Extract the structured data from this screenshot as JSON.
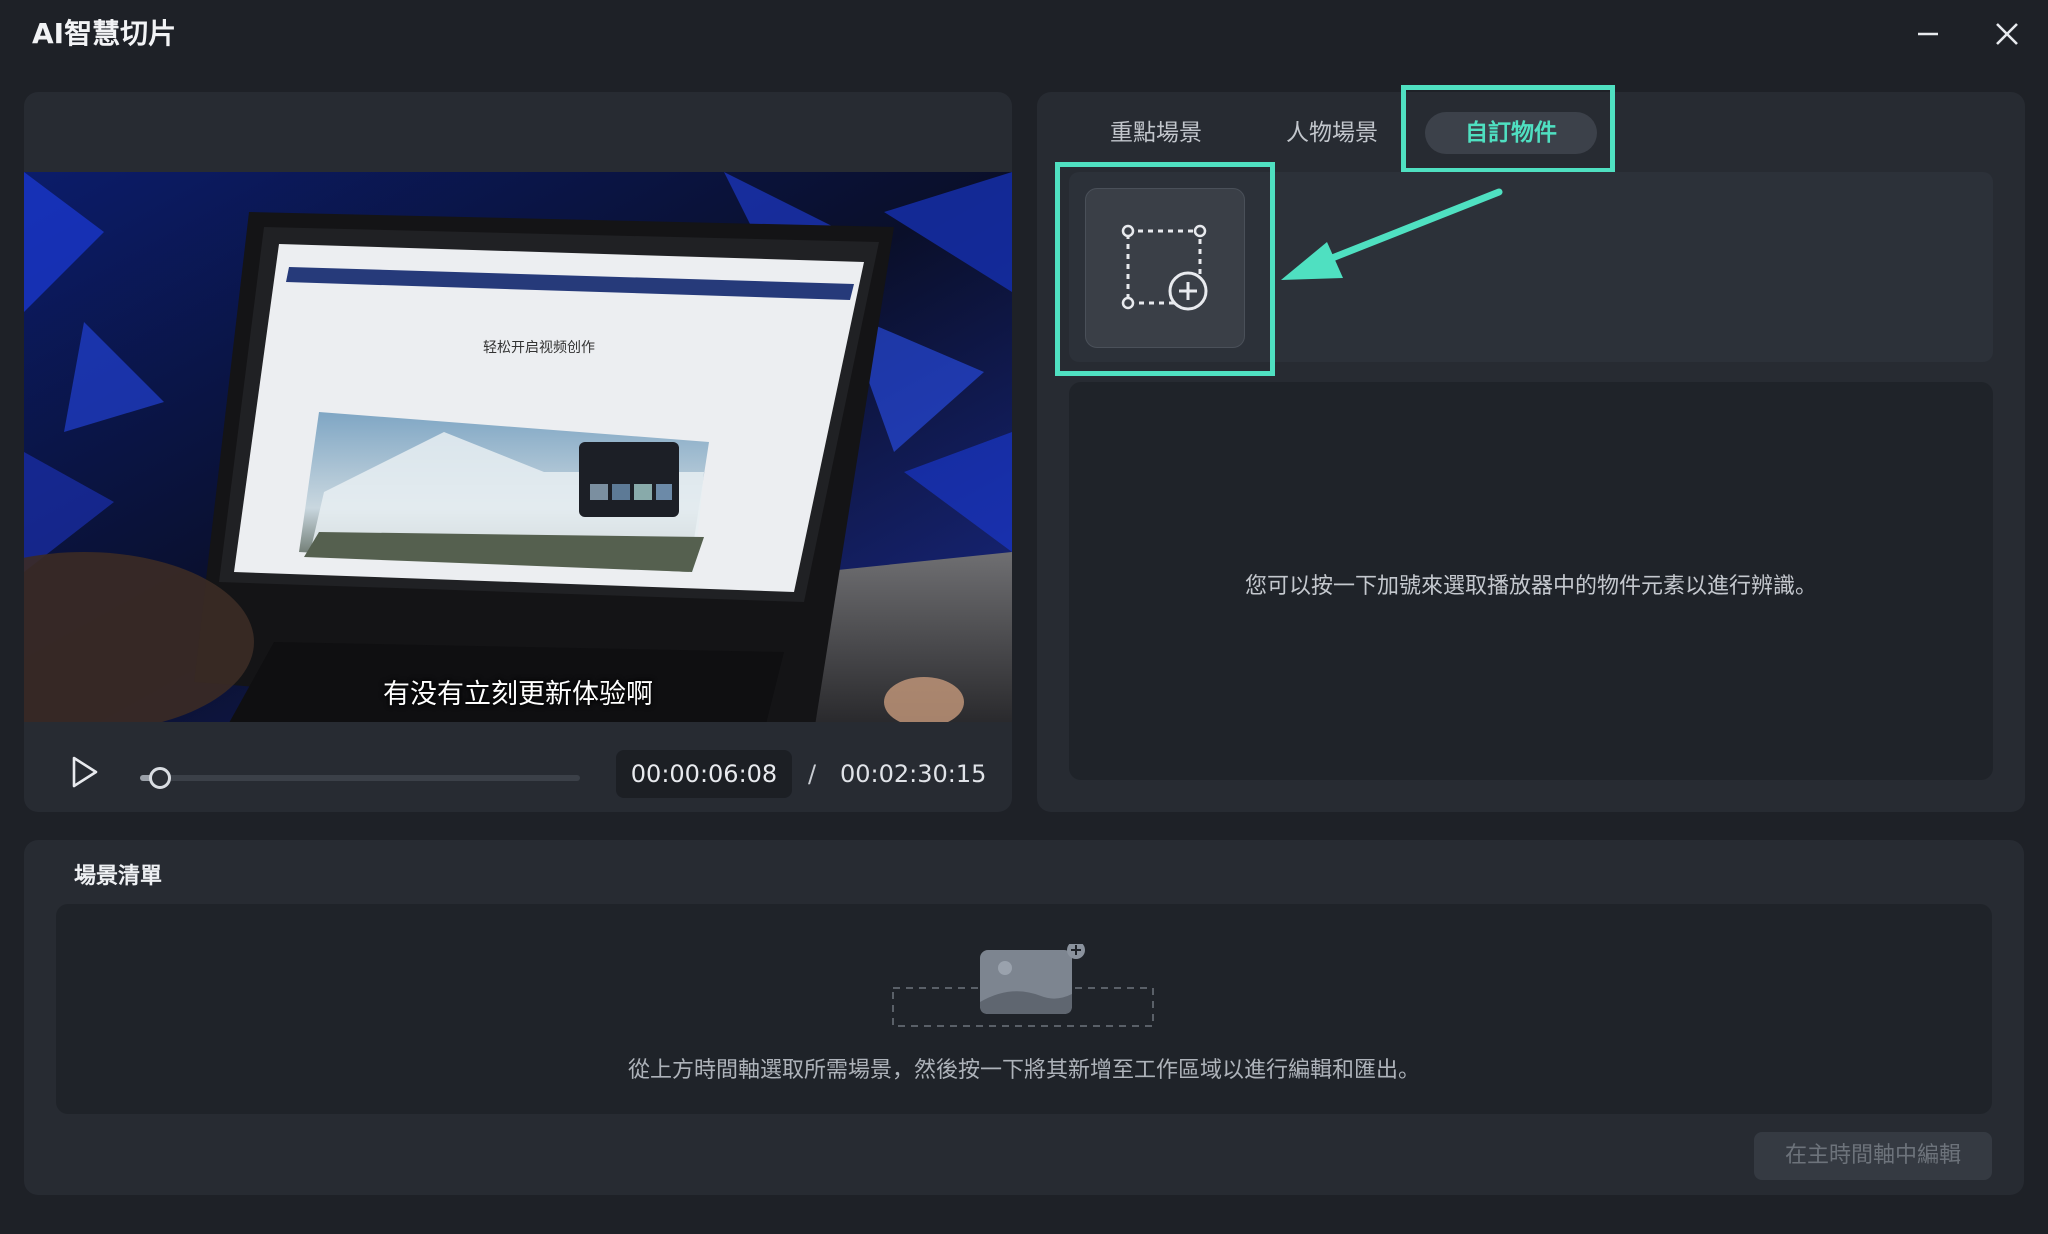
{
  "window": {
    "title": "AI智慧切片",
    "minimize_icon": "minimize-icon",
    "close_icon": "close-icon"
  },
  "player": {
    "subtitle": "有没有立刻更新体验啊",
    "current_time": "00:00:06:08",
    "separator": "/",
    "total_time": "00:02:30:15",
    "progress": 0.045,
    "play_icon": "play-icon",
    "video_screen_text": "轻松开启视频创作"
  },
  "tabs": [
    {
      "label": "重點場景",
      "active": false
    },
    {
      "label": "人物場景",
      "active": false
    },
    {
      "label": "自訂物件",
      "active": true
    }
  ],
  "custom_object": {
    "add_icon": "add-selection-icon",
    "hint": "您可以按一下加號來選取播放器中的物件元素以進行辨識。"
  },
  "scene_list": {
    "title": "場景清單",
    "hint": "從上方時間軸選取所需場景，然後按一下將其新增至工作區域以進行編輯和匯出。",
    "edit_button": "在主時間軸中編輯"
  },
  "colors": {
    "accent": "#4fe0c1",
    "background": "#1e2127",
    "panel": "#272b32"
  }
}
